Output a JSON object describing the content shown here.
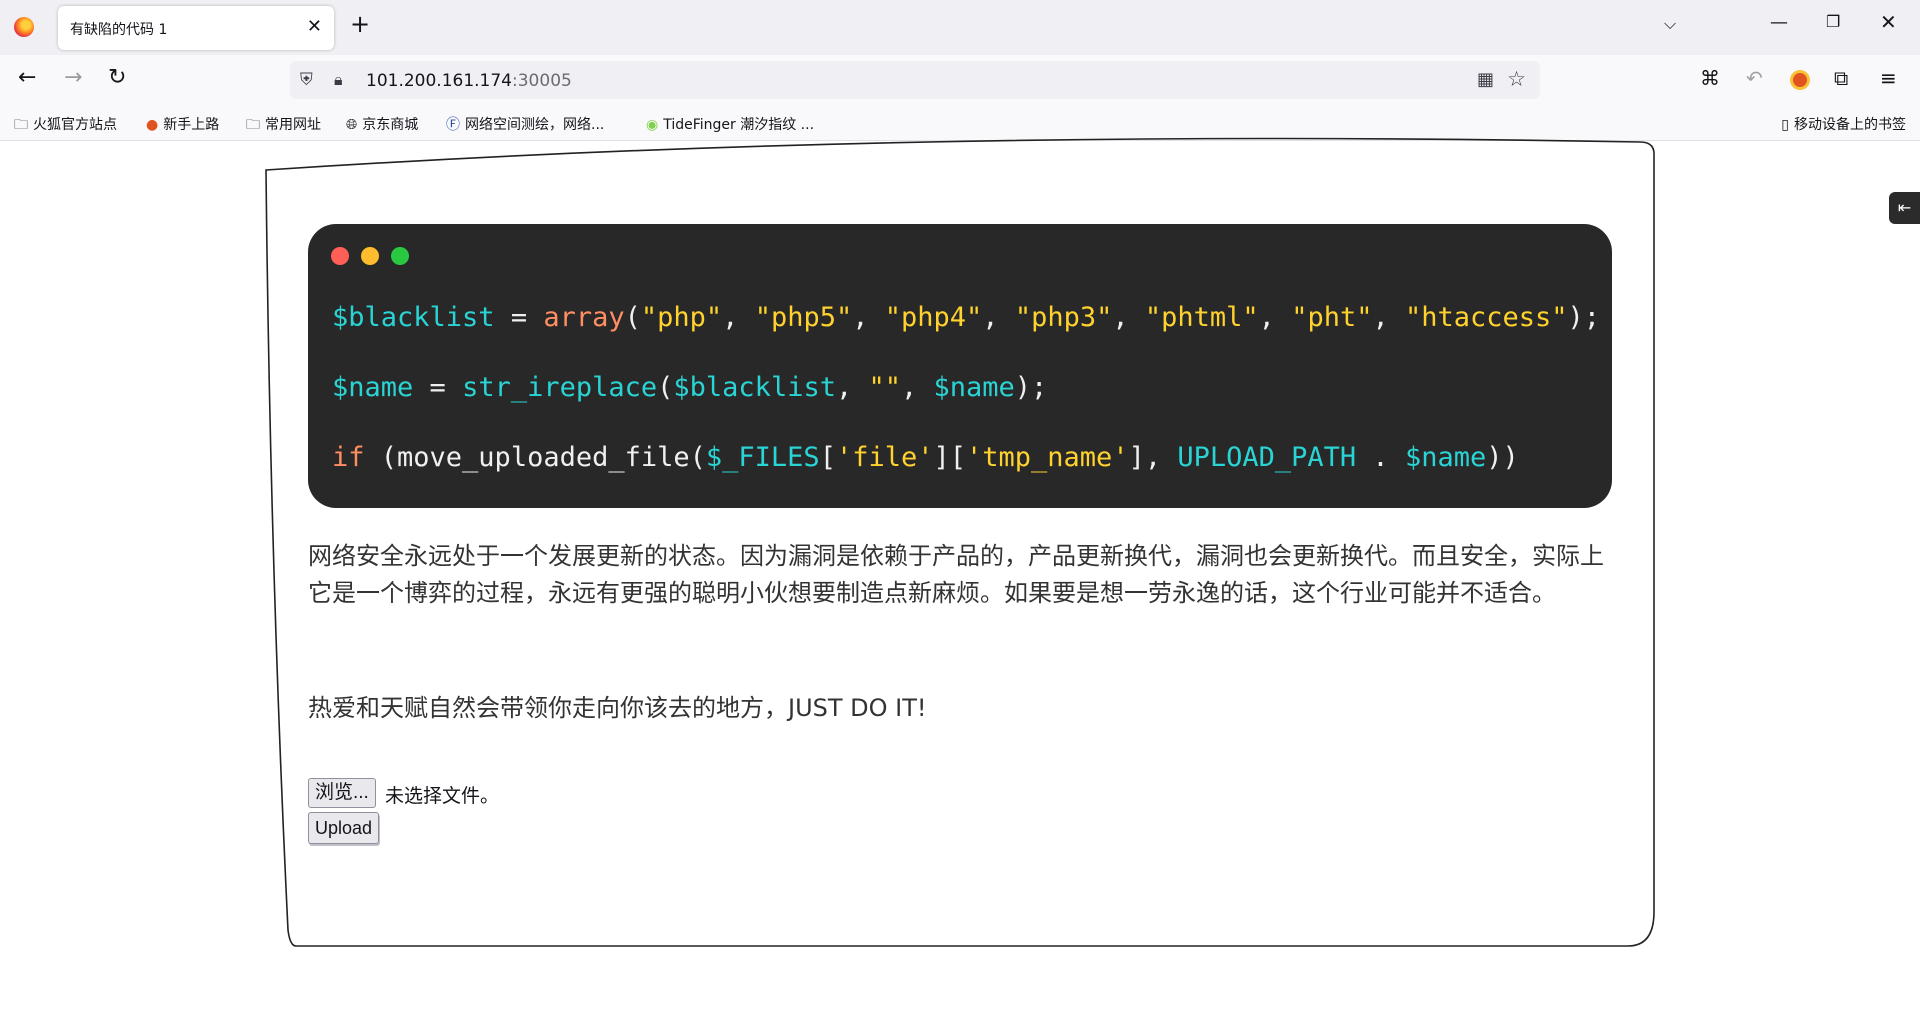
{
  "browser": {
    "tab": {
      "title": "有缺陷的代码 1",
      "close_glyph": "✕"
    },
    "new_tab_glyph": "+",
    "list_tabs_glyph": "⌵",
    "window_controls": {
      "minimize": "—",
      "maximize": "❐",
      "close": "✕"
    },
    "nav": {
      "back": "←",
      "forward": "→",
      "reload": "↻"
    },
    "url": {
      "host": "101.200.161.174",
      "port": ":30005"
    },
    "bookmarks": [
      {
        "label": "火狐官方站点",
        "icon": "folder-icon"
      },
      {
        "label": "新手上路",
        "icon": "firefox-icon"
      },
      {
        "label": "常用网址",
        "icon": "folder-icon"
      },
      {
        "label": "京东商城",
        "icon": "globe-icon"
      },
      {
        "label": "网络空间测绘，网络...",
        "icon": "site-icon"
      },
      {
        "label": "TideFinger 潮汐指纹 ...",
        "icon": "fingerprint-icon"
      }
    ],
    "mobile_bookmarks": "移动设备上的书签"
  },
  "code": {
    "line1": {
      "var": "$blacklist",
      "op": " = ",
      "fn": "array",
      "open": "(",
      "items": [
        "\"php\"",
        "\"php5\"",
        "\"php4\"",
        "\"php3\"",
        "\"phtml\"",
        "\"pht\"",
        "\"htaccess\""
      ],
      "sep": ", ",
      "close": ");"
    },
    "line2": {
      "var": "$name",
      "op": " = ",
      "fn": "str_ireplace",
      "open": "(",
      "arg1": "$blacklist",
      "sep1": ", ",
      "arg2": "\"\"",
      "sep2": ", ",
      "arg3": "$name",
      "close": ");"
    },
    "line3": {
      "kw": "if",
      "pre": " (move_uploaded_file(",
      "files": "$_FILES",
      "b1": "[",
      "k1": "'file'",
      "b2": "][",
      "k2": "'tmp_name'",
      "b3": "], ",
      "const": "UPLOAD_PATH",
      "dot": " . ",
      "var": "$name",
      "close": "))"
    }
  },
  "content": {
    "paragraph1": "网络安全永远处于一个发展更新的状态。因为漏洞是依赖于产品的，产品更新换代，漏洞也会更新换代。而且安全，实际上它是一个博弈的过程，永远有更强的聪明小伙想要制造点新麻烦。如果要是想一劳永逸的话，这个行业可能并不适合。",
    "paragraph2": "热爱和天赋自然会带领你走向你该去的地方，JUST DO IT!"
  },
  "form": {
    "browse_label": "浏览...",
    "file_status": "未选择文件。",
    "upload_label": "Upload"
  },
  "colors": {
    "code_bg": "#282828",
    "variable": "#2ad4d4",
    "function": "#ff8e62",
    "string": "#ffd22e"
  }
}
